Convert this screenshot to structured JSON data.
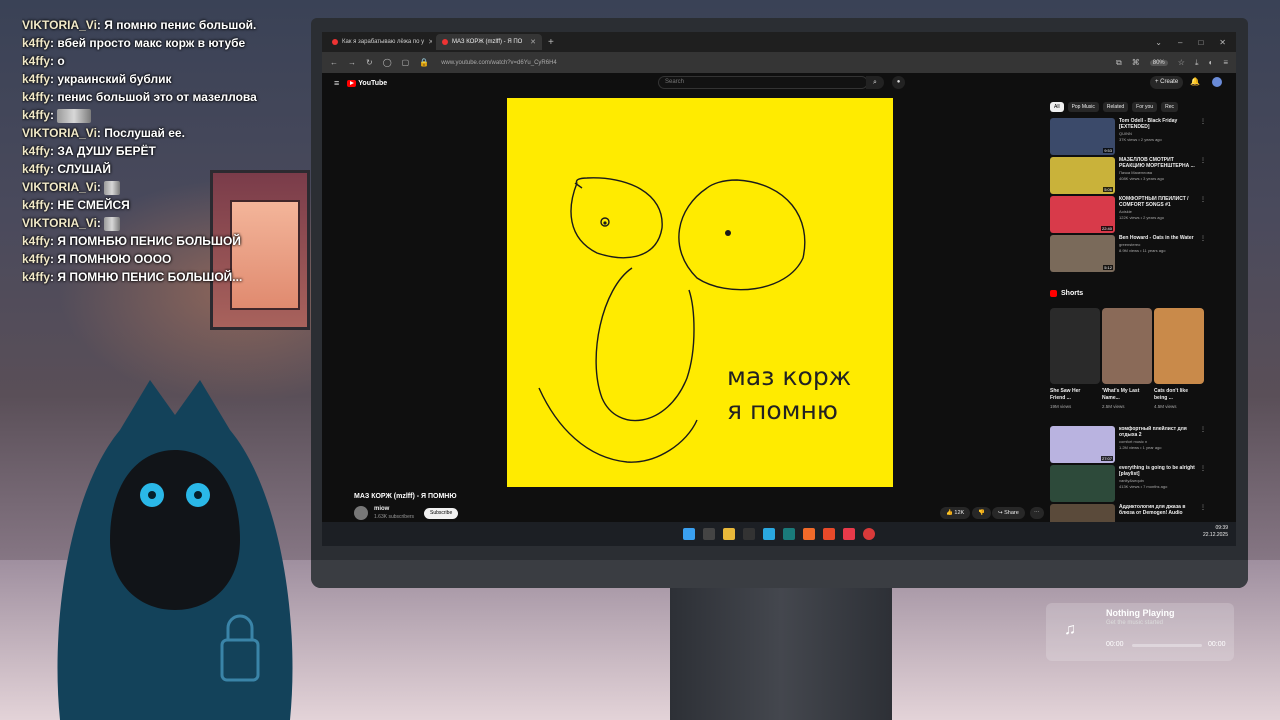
{
  "chat": [
    {
      "user": "VIKTORIA_Vi",
      "text": "Я помню пенис большой.",
      "user_color": "#efe6c3"
    },
    {
      "user": "k4ffy",
      "text": "вбей просто макс корж в ютубе"
    },
    {
      "user": "k4ffy",
      "text": "о"
    },
    {
      "user": "k4ffy",
      "text": "украинский бублик"
    },
    {
      "user": "k4ffy",
      "text": "пенис большой это от мазеллова"
    },
    {
      "user": "k4ffy",
      "text": "",
      "emote": "emote-wide"
    },
    {
      "user": "VIKTORIA_Vi",
      "text": "Послушай ее."
    },
    {
      "user": "k4ffy",
      "text": "ЗА ДУШУ БЕРЁТ"
    },
    {
      "user": "k4ffy",
      "text": "СЛУШАЙ"
    },
    {
      "user": "VIKTORIA_Vi",
      "text": "",
      "emote": "emote-small"
    },
    {
      "user": "k4ffy",
      "text": "НЕ СМЕЙСЯ"
    },
    {
      "user": "VIKTORIA_Vi",
      "text": "",
      "emote": "emote-small"
    },
    {
      "user": "k4ffy",
      "text": "Я ПОМНБЮ ПЕНИС БОЛЬШОЙ"
    },
    {
      "user": "k4ffy",
      "text": "Я ПОМНЮЮ ОООО"
    },
    {
      "user": "k4ffy",
      "text": "Я ПОМНЮ ПЕНИС БОЛЬШОЙ..."
    }
  ],
  "browser": {
    "tabs": [
      {
        "label": "Как я зарабатываю лёжа по у"
      },
      {
        "label": "МАЗ КОРЖ (mzlff) - Я ПО"
      }
    ],
    "new_tab": "+",
    "url": "www.youtube.com/watch?v=d6Yu_CyR6H4",
    "zoom": "80%"
  },
  "youtube": {
    "logo": "YouTube",
    "search_placeholder": "Search",
    "create": "+ Create",
    "video_caption_1": "маз корж",
    "video_caption_2": "я помню",
    "video_title": "МАЗ КОРЖ (mzlff) - Я ПОМНЮ",
    "channel": "miow",
    "subs": "1.63K subscribers",
    "subscribe": "Subscribe",
    "likes": "12K",
    "share": "Share",
    "chips": [
      "All",
      "Pop Music",
      "Related",
      "For you",
      "Rec"
    ],
    "recs": [
      {
        "title": "Tom Odell - Black Friday [EXTENDED]",
        "channel": "QUINN",
        "views": "37K views • 2 years ago",
        "dur": "9:53",
        "color": "#3b4a6a"
      },
      {
        "title": "МАЗЕЛЛОВ СМОТРИТ РЕАКЦИЮ МОРГЕНШТЕРНА ...",
        "channel": "Пачка Мазеллова",
        "views": "408K views • 3 years ago",
        "dur": "5:06",
        "color": "#c9b23a"
      },
      {
        "title": "КОМФОРТНЫЙ ПЛЕЙЛИСТ / COMFORT SONGS #1",
        "channel": "Aoiskie",
        "views": "122K views • 2 years ago",
        "dur": "22:40",
        "color": "#d83a4a"
      },
      {
        "title": "Ben Howard - Oats in the Water",
        "channel": "greenstereo",
        "views": "8.9M views • 11 years ago",
        "dur": "5:12",
        "color": "#7a6a5a"
      }
    ],
    "shorts_header": "Shorts",
    "shorts": [
      {
        "title": "She Saw Her Friend ...",
        "views": "19M views",
        "color": "#2a2a2a"
      },
      {
        "title": "'What's My Last Name...",
        "views": "2.5M views",
        "color": "#8a6a58"
      },
      {
        "title": "Cats don't like being ...",
        "views": "4.5M views",
        "color": "#c98a4a"
      }
    ],
    "recs2": [
      {
        "title": "комфортный плейлист для отдыха 2",
        "channel": "comfort music n",
        "views": "1.2M views • 1 year ago",
        "dur": "27:07",
        "color": "#b9b3e0"
      },
      {
        "title": "everything is going to be alright [playlist]",
        "channel": "vanity&sequin",
        "views": "413K views • 7 months ago",
        "dur": "",
        "color": "#2d4a3a"
      },
      {
        "title": "Аддиктология для джаза в блюза от Demogen! Audio",
        "channel": "",
        "views": "",
        "dur": "",
        "color": "#5a4a3a"
      }
    ]
  },
  "taskbar": {
    "time": "09:39",
    "date": "22.12.2025"
  },
  "music": {
    "title": "Nothing Playing",
    "subtitle": "Get the music started",
    "start": "00:00",
    "end": "00:00"
  }
}
